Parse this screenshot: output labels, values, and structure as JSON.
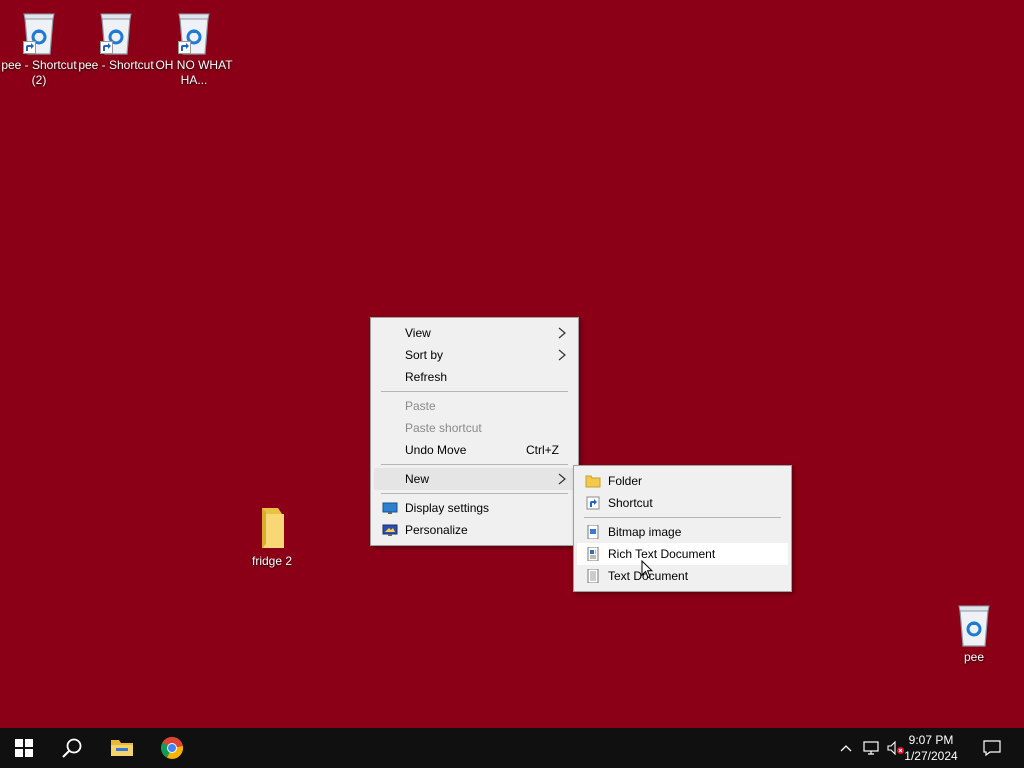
{
  "desktop": {
    "background_color": "#8b0016",
    "icons": [
      {
        "label": "pee - Shortcut (2)",
        "icon": "recycle-bin-icon",
        "shortcut": true
      },
      {
        "label": "pee - Shortcut",
        "icon": "recycle-bin-icon",
        "shortcut": true
      },
      {
        "label": "OH NO WHAT HA...",
        "icon": "recycle-bin-icon",
        "shortcut": true
      },
      {
        "label": "fridge 2",
        "icon": "folder-icon",
        "shortcut": false
      },
      {
        "label": "pee",
        "icon": "recycle-bin-icon",
        "shortcut": false
      }
    ]
  },
  "context_menu": {
    "items": [
      {
        "label": "View",
        "submenu": true
      },
      {
        "label": "Sort by",
        "submenu": true
      },
      {
        "label": "Refresh"
      },
      {
        "label": "Paste",
        "disabled": true
      },
      {
        "label": "Paste shortcut",
        "disabled": true
      },
      {
        "label": "Undo Move",
        "accelerator": "Ctrl+Z"
      },
      {
        "label": "New",
        "submenu": true,
        "open": true
      },
      {
        "label": "Display settings",
        "icon": "display-settings-icon"
      },
      {
        "label": "Personalize",
        "icon": "personalize-icon"
      }
    ]
  },
  "new_submenu": {
    "items": [
      {
        "label": "Folder",
        "icon": "folder-icon"
      },
      {
        "label": "Shortcut",
        "icon": "shortcut-icon"
      },
      {
        "label": "Bitmap image",
        "icon": "bitmap-icon"
      },
      {
        "label": "Rich Text Document",
        "icon": "rich-text-icon",
        "hovered": true
      },
      {
        "label": "Text Document",
        "icon": "text-document-icon"
      }
    ]
  },
  "taskbar": {
    "pinned": [
      "start-icon",
      "search-icon",
      "file-explorer-icon",
      "chrome-icon"
    ],
    "tray_icons": [
      "chevron-up-icon",
      "network-icon",
      "volume-muted-icon"
    ],
    "clock": {
      "time": "9:07 PM",
      "date": "1/27/2024"
    },
    "notification_icon": "action-center-icon"
  }
}
